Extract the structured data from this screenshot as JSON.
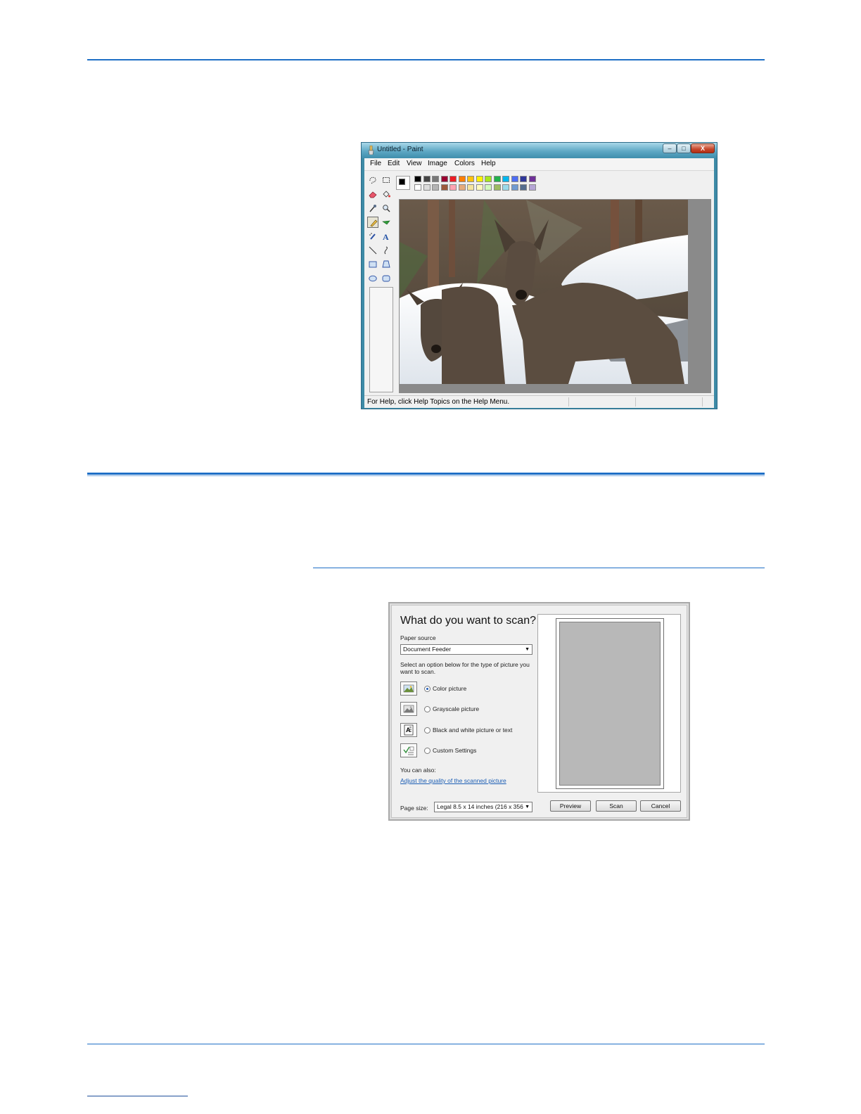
{
  "paint": {
    "title": "Untitled - Paint",
    "window_buttons": {
      "minimize": "–",
      "maximize": "□",
      "close": "X"
    },
    "menus": [
      {
        "label": "File"
      },
      {
        "label": "Edit"
      },
      {
        "label": "View"
      },
      {
        "label": "Image"
      },
      {
        "label": "Colors"
      },
      {
        "label": "Help"
      }
    ],
    "tools": [
      "free-form-select-icon",
      "rect-select-icon",
      "eraser-icon",
      "fill-bucket-icon",
      "color-picker-icon",
      "magnifier-icon",
      "pencil-icon",
      "brush-icon",
      "airbrush-icon",
      "text-tool-icon",
      "line-icon",
      "curve-icon",
      "rectangle-icon",
      "polygon-icon",
      "ellipse-icon",
      "rounded-rect-icon"
    ],
    "active_tool": "pencil-icon",
    "palette": {
      "foreground": "#000000",
      "background": "#ffffff",
      "top_row": [
        "#000000",
        "#464646",
        "#787878",
        "#990030",
        "#ed1c24",
        "#ff7e00",
        "#ffc20e",
        "#fff200",
        "#a8e61d",
        "#22b14c",
        "#00b7ef",
        "#4d6df3",
        "#2f3699",
        "#6f3198"
      ],
      "bottom_row": [
        "#ffffff",
        "#dcdcdc",
        "#b4b4b4",
        "#9c5a3c",
        "#ffa3b1",
        "#e5aa7a",
        "#f5e49c",
        "#fff9bd",
        "#d3f9bc",
        "#9dbb61",
        "#99d9ea",
        "#709ad1",
        "#546d8e",
        "#b5a5d5"
      ]
    },
    "status": "For Help, click Help Topics on the Help Menu."
  },
  "scan": {
    "heading": "What do you want to scan?",
    "paper_source_label": "Paper source",
    "paper_source_value": "Document Feeder",
    "instruction_line1": "Select an option below for the type of picture you",
    "instruction_line2": "want to scan.",
    "options": [
      {
        "label": "Color picture",
        "selected": true,
        "icon": "color-picture-icon"
      },
      {
        "label": "Grayscale picture",
        "selected": false,
        "icon": "grayscale-picture-icon"
      },
      {
        "label": "Black and white picture or text",
        "selected": false,
        "icon": "bw-picture-icon"
      },
      {
        "label": "Custom Settings",
        "selected": false,
        "icon": "custom-settings-icon"
      }
    ],
    "also_label": "You can also:",
    "adjust_link": "Adjust the quality of the scanned picture",
    "page_size_label": "Page size:",
    "page_size_value": "Legal 8.5 x 14 inches (216 x 356",
    "buttons": {
      "preview": "Preview",
      "scan": "Scan",
      "cancel": "Cancel"
    }
  }
}
